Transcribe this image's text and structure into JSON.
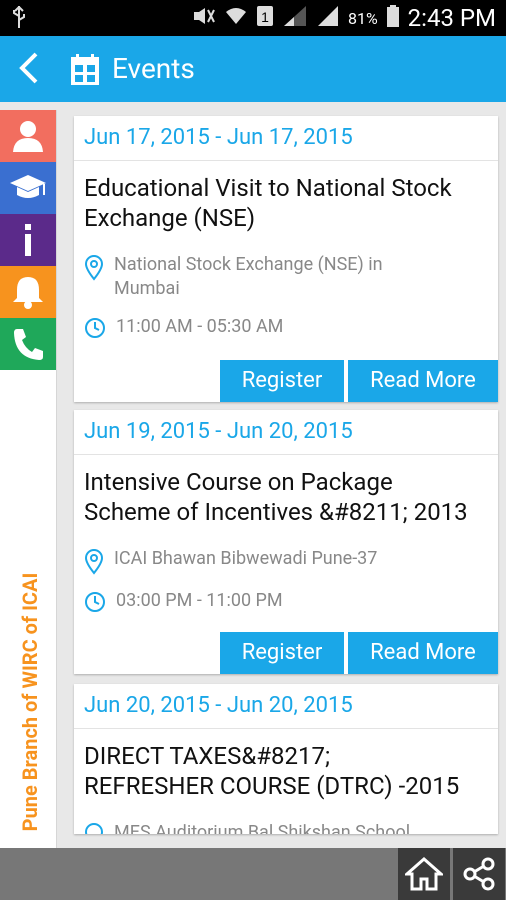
{
  "status_bar": {
    "battery": "81%",
    "time": "2:43 PM",
    "sim": "1"
  },
  "app_bar": {
    "title": "Events"
  },
  "side_menu": {
    "items": [
      {
        "name": "profile-icon",
        "color": "#f26e5f"
      },
      {
        "name": "graduation-cap-icon",
        "color": "#3a6fd0"
      },
      {
        "name": "info-icon",
        "color": "#5b2a8a"
      },
      {
        "name": "bell-icon",
        "color": "#f7931e"
      },
      {
        "name": "phone-icon",
        "color": "#1fa85a"
      }
    ],
    "vertical_label": "Pune Branch of WIRC of ICAI"
  },
  "events": [
    {
      "date": "Jun 17, 2015 - Jun 17, 2015",
      "title_line1": "Educational Visit to National Stock",
      "title_line2": "Exchange (NSE)",
      "venue_line1": "National Stock Exchange (NSE)  in",
      "venue_line2": "Mumbai",
      "time": "11:00 AM - 05:30 AM",
      "register_label": "Register",
      "read_more_label": "Read More"
    },
    {
      "date": "Jun 19, 2015 - Jun 20, 2015",
      "title_line1": "Intensive Course on Package",
      "title_line2": "Scheme of Incentives &#8211; 2013",
      "venue_line1": "ICAI Bhawan Bibwewadi Pune-37",
      "time": "03:00 PM - 11:00 PM",
      "register_label": "Register",
      "read_more_label": "Read More"
    },
    {
      "date": "Jun 20, 2015 - Jun 20, 2015",
      "title_line1": "DIRECT TAXES&#8217;",
      "title_line2": "REFRESHER COURSE (DTRC) -2015",
      "venue_line1": "MES Auditorium Bal Shikshan School"
    }
  ],
  "colors": {
    "primary": "#1aa7e8",
    "accent": "#f7931e"
  }
}
